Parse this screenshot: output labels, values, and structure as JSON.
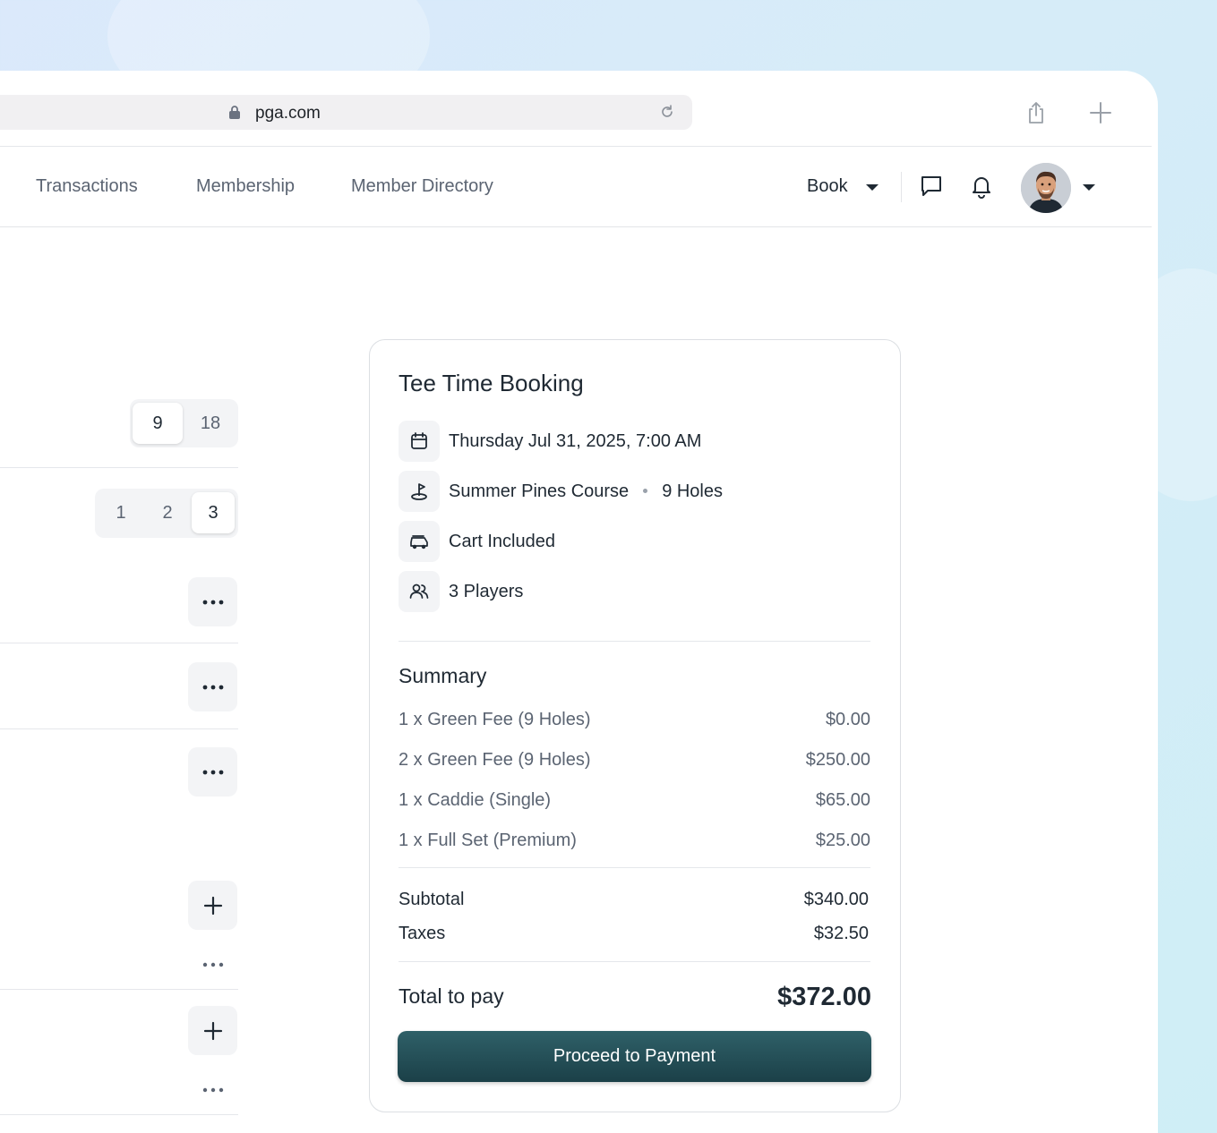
{
  "browser": {
    "url": "pga.com",
    "icons": {
      "lock": "lock-icon",
      "reload": "reload-icon",
      "share": "share-icon",
      "new_tab": "plus-icon"
    }
  },
  "nav": {
    "links": [
      "Transactions",
      "Membership",
      "Member Directory"
    ],
    "book_label": "Book",
    "icons": {
      "chat": "chat-icon",
      "notifications": "bell-icon",
      "avatar_menu": "chevron-down-icon"
    }
  },
  "left_panel": {
    "holes_options": [
      "9",
      "18"
    ],
    "holes_selected": "9",
    "players_options": [
      "1",
      "2",
      "3"
    ],
    "players_selected": "3"
  },
  "booking": {
    "title": "Tee Time Booking",
    "datetime": "Thursday Jul 31, 2025, 7:00 AM",
    "course": "Summer Pines Course",
    "holes": "9 Holes",
    "cart": "Cart Included",
    "players": "3 Players"
  },
  "summary": {
    "title": "Summary",
    "items": [
      {
        "label": "1 x Green Fee (9 Holes)",
        "amount": "$0.00"
      },
      {
        "label": "2 x Green Fee (9 Holes)",
        "amount": "$250.00"
      },
      {
        "label": "1 x Caddie (Single)",
        "amount": "$65.00"
      },
      {
        "label": "1 x Full Set (Premium)",
        "amount": "$25.00"
      }
    ],
    "subtotal_label": "Subtotal",
    "subtotal": "$340.00",
    "taxes_label": "Taxes",
    "taxes": "$32.50",
    "total_label": "Total to pay",
    "total": "$372.00",
    "cta": "Proceed to Payment"
  },
  "colors": {
    "primary": "#1f4a52",
    "text": "#1f2933",
    "muted": "#5b6472",
    "border": "#e5e7eb"
  }
}
